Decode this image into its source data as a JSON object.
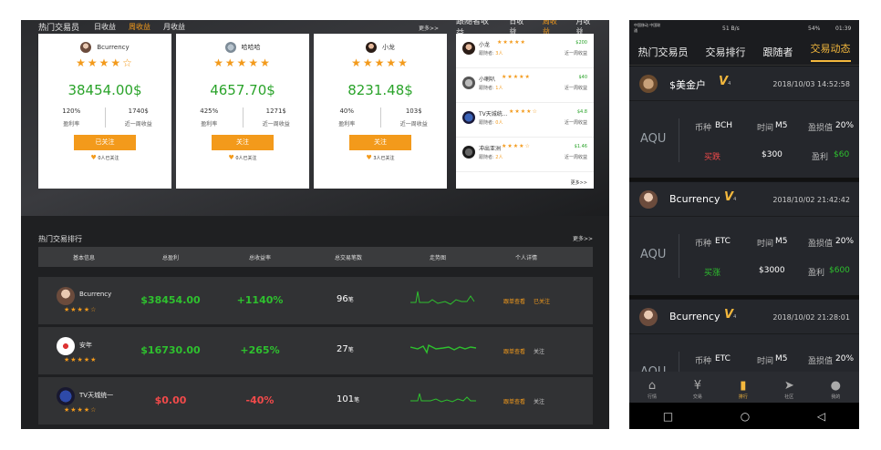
{
  "desktop": {
    "header": {
      "title": "热门交易员",
      "tabs": [
        "日收益",
        "周收益",
        "月收益"
      ],
      "active_tab": "周收益",
      "more": "更多>>",
      "follower_title": "跟随者收益",
      "follower_tabs": [
        "日收益",
        "周收益",
        "月收益"
      ],
      "follower_active_tab": "周收益"
    },
    "cards": [
      {
        "name": "Bcurrency",
        "stars": "★★★★☆",
        "profit": "38454.00$",
        "rate": "120%",
        "rate_label": "盈利率",
        "week": "1740$",
        "week_label": "近一周收益",
        "button": "已关注",
        "followers": "0人已关注"
      },
      {
        "name": "哈哈哈",
        "stars": "★★★★★",
        "profit": "4657.70$",
        "rate": "425%",
        "rate_label": "盈利率",
        "week": "1271$",
        "week_label": "近一周收益",
        "button": "关注",
        "followers": "0人已关注"
      },
      {
        "name": "小龙",
        "stars": "★★★★★",
        "profit": "8231.48$",
        "rate": "40%",
        "rate_label": "盈利率",
        "week": "103$",
        "week_label": "近一周收益",
        "button": "关注",
        "followers": "3人已关注"
      }
    ],
    "follower_list": [
      {
        "name": "小龙",
        "stars": "★★★★★",
        "sub": "跟随者:",
        "count": "3人",
        "amount": "$200",
        "period": "近一周收益"
      },
      {
        "name": "小喇叭",
        "stars": "★★★★★",
        "sub": "跟随者:",
        "count": "1人",
        "amount": "$40",
        "period": "近一周收益"
      },
      {
        "name": "TV天城统...",
        "stars": "★★★★☆",
        "sub": "跟随者:",
        "count": "0人",
        "amount": "$4.8",
        "period": "近一周收益"
      },
      {
        "name": "冲出亚洲",
        "stars": "★★★★☆",
        "sub": "跟随者:",
        "count": "2人",
        "amount": "$1.46",
        "period": "近一周收益"
      }
    ],
    "follower_more": "更多>>",
    "ranking": {
      "title": "热门交易排行",
      "more": "更多>>",
      "headers": [
        "基本信息",
        "总盈利",
        "总收益率",
        "总交易笔数",
        "走势图",
        "个人详情"
      ],
      "rows": [
        {
          "name": "Bcurrency",
          "stars": "★★★★☆",
          "profit": "$38454.00",
          "rate": "+1140%",
          "trades": "96",
          "unit": "笔",
          "action1": "跟单查看",
          "action2": "已关注"
        },
        {
          "name": "安年",
          "stars": "★★★★★",
          "profit": "$16730.00",
          "rate": "+265%",
          "trades": "27",
          "unit": "笔",
          "action1": "跟单查看",
          "action2": "关注"
        },
        {
          "name": "TV天城统一",
          "stars": "★★★★☆",
          "profit": "$0.00",
          "rate": "-40%",
          "trades": "101",
          "unit": "笔",
          "action1": "跟单查看",
          "action2": "关注"
        }
      ]
    }
  },
  "mobile": {
    "status": {
      "carrier": "中国移动 中国联通",
      "net": "51 B/s",
      "battery": "54%",
      "time": "01:39"
    },
    "tabs": [
      "热门交易员",
      "交易排行",
      "跟随者",
      "交易动态"
    ],
    "active_tab": "交易动态",
    "trades": [
      {
        "name": "$美金户",
        "vip": "4",
        "date": "2018/10/03 14:52:58",
        "symbol": "AQU",
        "coin_label": "币种",
        "coin": "BCH",
        "period_label": "时间",
        "period": "M5",
        "ratio_label": "盈损值",
        "ratio": "20%",
        "side": "买跌",
        "amount": "$300",
        "profit_label": "盈利",
        "profit": "$60"
      },
      {
        "name": "Bcurrency",
        "vip": "4",
        "date": "2018/10/02 21:42:42",
        "symbol": "AQU",
        "coin_label": "币种",
        "coin": "ETC",
        "period_label": "时间",
        "period": "M5",
        "ratio_label": "盈损值",
        "ratio": "20%",
        "side": "买涨",
        "amount": "$3000",
        "profit_label": "盈利",
        "profit": "$600"
      },
      {
        "name": "Bcurrency",
        "vip": "4",
        "date": "2018/10/02 21:28:01",
        "symbol": "AQU",
        "coin_label": "币种",
        "coin": "ETC",
        "period_label": "时间",
        "period": "M5",
        "ratio_label": "盈损值",
        "ratio": "20%"
      }
    ],
    "nav": [
      "行情",
      "交易",
      "排行",
      "社区",
      "我的"
    ],
    "active_nav": "排行"
  }
}
